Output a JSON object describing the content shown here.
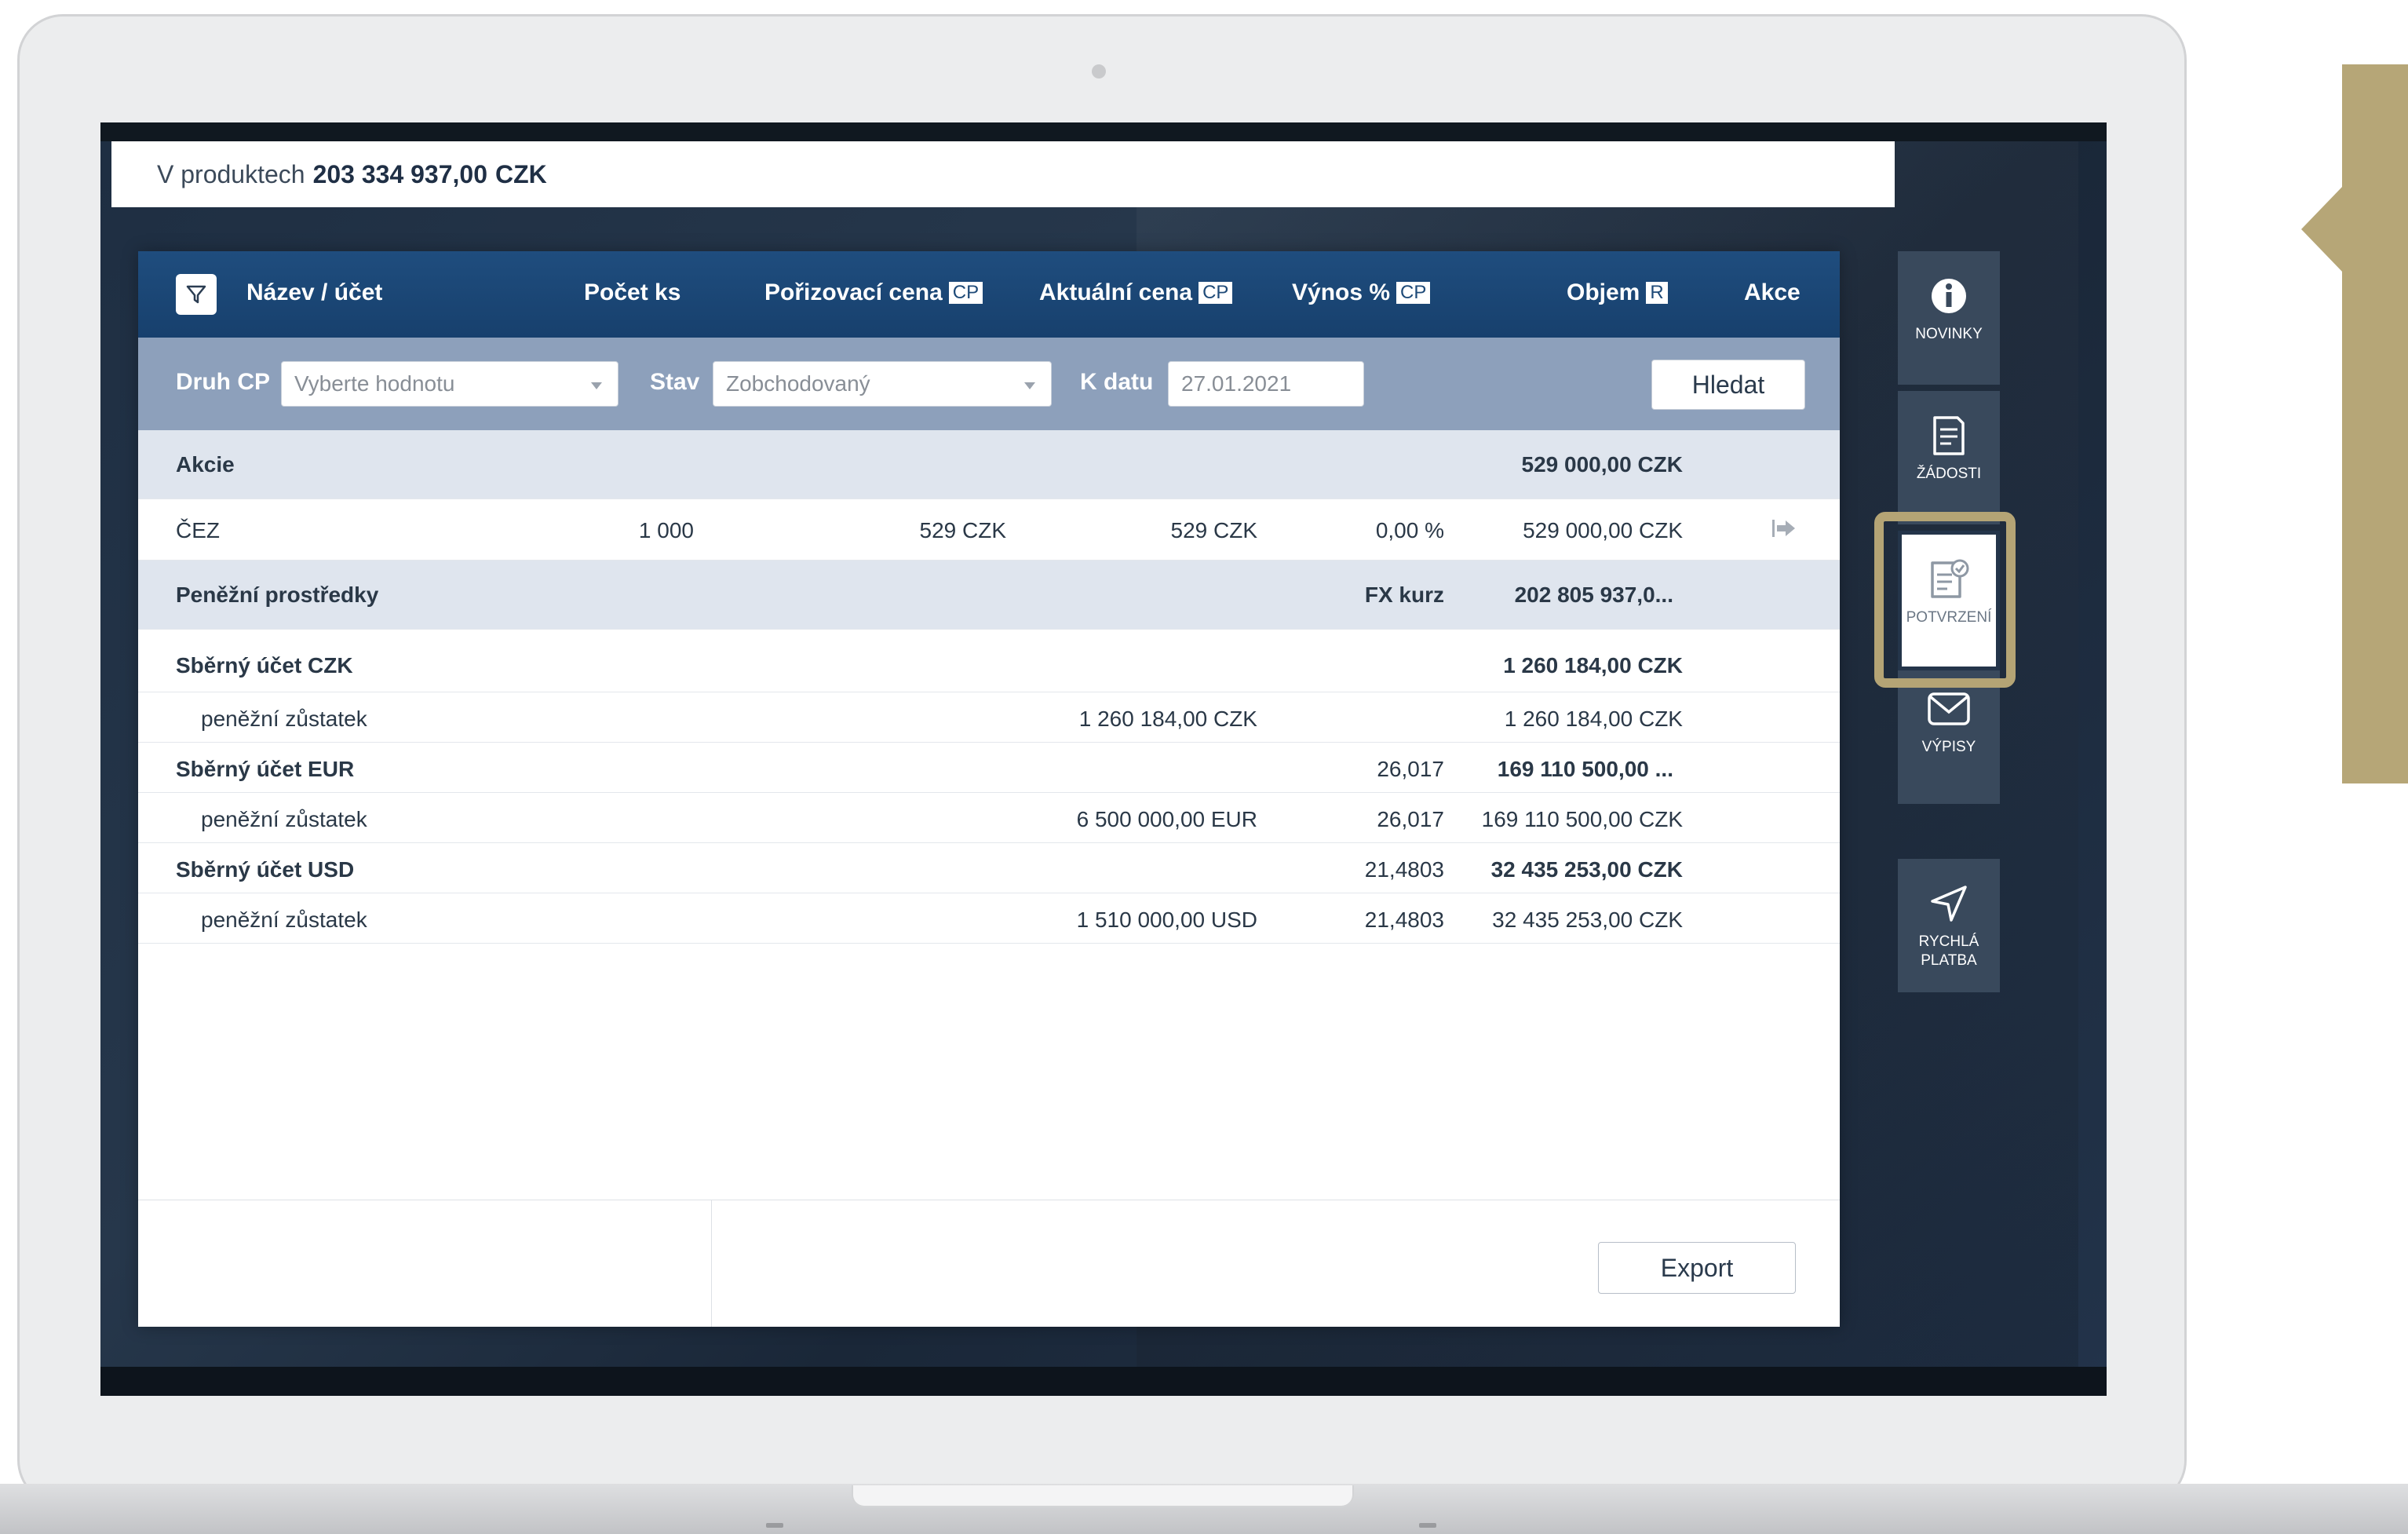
{
  "header": {
    "label": "V produktech",
    "total": "203 334 937,00",
    "currency": "CZK"
  },
  "columns": {
    "name": "Název / účet",
    "count": "Počet ks",
    "purchase": "Pořizovací cena",
    "current": "Aktuální cena",
    "yield": "Výnos %",
    "volume": "Objem",
    "actions": "Akce",
    "badge_cp": "CP",
    "badge_r": "R"
  },
  "filters": {
    "druh_label": "Druh CP",
    "druh_placeholder": "Vyberte hodnotu",
    "stav_label": "Stav",
    "stav_value": "Zobchodovaný",
    "date_label": "K datu",
    "date_value": "27.01.2021",
    "search_label": "Hledat"
  },
  "akcie": {
    "group": "Akcie",
    "total": "529 000,00 CZK",
    "row": {
      "name": "ČEZ",
      "count": "1 000",
      "purchase": "529 CZK",
      "current": "529 CZK",
      "yield": "0,00 %",
      "volume": "529 000,00 CZK"
    }
  },
  "cash": {
    "group": "Peněžní prostředky",
    "fx_label": "FX kurz",
    "total": "202 805 937,0...",
    "czk_title": "Sběrný účet CZK",
    "czk_total": "1 260 184,00 CZK",
    "czk_sub": "peněžní zůstatek",
    "czk_sub_amount": "1 260 184,00 CZK",
    "czk_sub_volume": "1 260 184,00 CZK",
    "eur_title": "Sběrný účet EUR",
    "eur_fx": "26,017",
    "eur_total": "169 110 500,00 ...",
    "eur_sub": "peněžní zůstatek",
    "eur_sub_amount": "6 500 000,00 EUR",
    "eur_sub_fx": "26,017",
    "eur_sub_volume": "169 110 500,00 CZK",
    "usd_title": "Sběrný účet USD",
    "usd_fx": "21,4803",
    "usd_total": "32 435 253,00 CZK",
    "usd_sub": "peněžní zůstatek",
    "usd_sub_amount": "1 510 000,00 USD",
    "usd_sub_fx": "21,4803",
    "usd_sub_volume": "32 435 253,00 CZK"
  },
  "footer": {
    "export_label": "Export"
  },
  "sidebar": {
    "novinky": "NOVINKY",
    "zadosti": "ŽÁDOSTI",
    "potvrzeni": "POTVRZENÍ",
    "vypisy": "VÝPISY",
    "rychla_1": "RYCHLÁ",
    "rychla_2": "PLATBA"
  },
  "colors": {
    "header_blue": "#1f4d7e",
    "filter_bar": "#8da0bb",
    "highlight_gold": "#b4a475"
  }
}
